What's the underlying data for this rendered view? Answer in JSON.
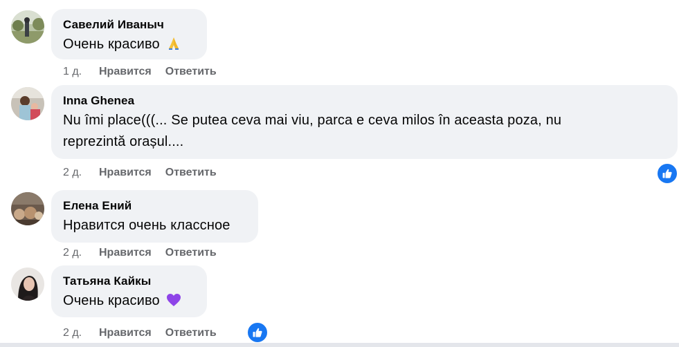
{
  "comments": [
    {
      "author": "Савелий Иваныч",
      "text": "Очень красиво",
      "emoji": "folded-hands-emoji",
      "time": "1 д.",
      "like_label": "Нравится",
      "reply_label": "Ответить",
      "reactions": 0
    },
    {
      "author": "Inna Ghenea",
      "text_line1": "Nu îmi place(((... Se putea ceva mai viu, parca e ceva milos în aceasta poza, nu",
      "text_line2": "reprezintă orașul....",
      "time": "2 д.",
      "like_label": "Нравится",
      "reply_label": "Ответить",
      "reactions": 1
    },
    {
      "author": "Елена Ений",
      "text": "Нравится очень классное",
      "time": "2 д.",
      "like_label": "Нравится",
      "reply_label": "Ответить",
      "reactions": 0
    },
    {
      "author": "Татьяна Кайкы",
      "text": "Очень красиво",
      "emoji": "purple-heart-emoji",
      "time": "2 д.",
      "like_label": "Нравится",
      "reply_label": "Ответить",
      "reactions": 1
    }
  ],
  "colors": {
    "bubble": "#f0f2f5",
    "meta_text": "#65676b",
    "like_blue": "#1877f2",
    "heart_purple": "#8e44e8"
  }
}
